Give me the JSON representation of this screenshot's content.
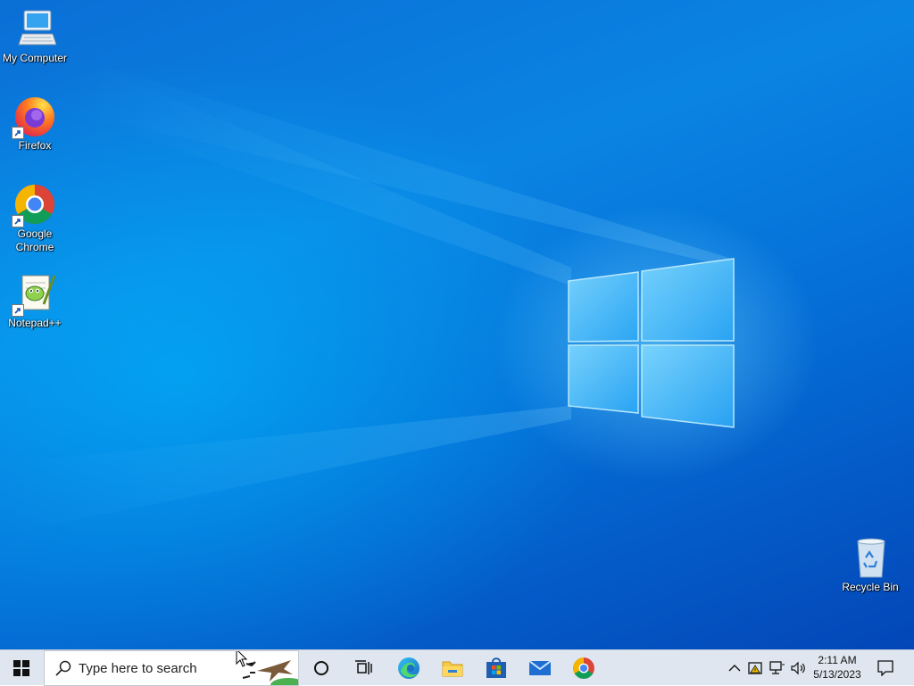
{
  "desktop": {
    "icons": [
      {
        "label": "My Computer"
      },
      {
        "label": "Firefox"
      },
      {
        "label": "Google\nChrome"
      },
      {
        "label": "Notepad++"
      },
      {
        "label": "Recycle Bin"
      }
    ]
  },
  "taskbar": {
    "search_placeholder": "Type here to search",
    "pinned": [
      "start-icon",
      "cortana-icon",
      "task-view-icon",
      "edge-icon",
      "file-explorer-icon",
      "microsoft-store-icon",
      "mail-icon",
      "chrome-icon"
    ],
    "clock": {
      "time": "2:11 AM",
      "date": "5/13/2023"
    }
  },
  "colors": {
    "taskbar": "#dfe6ef",
    "desktop_blue": "#0a84e3"
  }
}
